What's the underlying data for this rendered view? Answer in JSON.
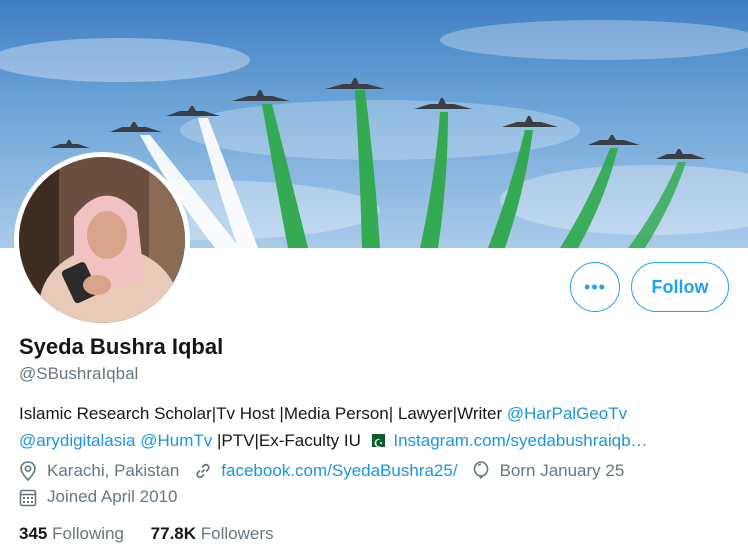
{
  "profile": {
    "name": "Syeda Bushra Iqbal",
    "handle": "@SBushraIqbal",
    "bio": {
      "text1": "Islamic Research Scholar|Tv Host |Media Person| Lawyer|Writer ",
      "mention1": "@HarPalGeoTv",
      "mention2": "@arydigitalasia",
      "mention3": "@HumTv",
      "text2": " |PTV|Ex-Faculty IU ",
      "link": "Instagram.com/syedabushraiqb…"
    },
    "location": "Karachi, Pakistan",
    "website": "facebook.com/SyedaBushra25/",
    "birthday": "Born January 25",
    "joined": "Joined April 2010"
  },
  "stats": {
    "following_count": "345",
    "following_label": "Following",
    "followers_count": "77.8K",
    "followers_label": "Followers"
  },
  "actions": {
    "more_label": "•••",
    "follow_label": "Follow"
  },
  "colors": {
    "accent": "#1da1f2",
    "link": "#1b95e0",
    "muted": "#657786"
  }
}
